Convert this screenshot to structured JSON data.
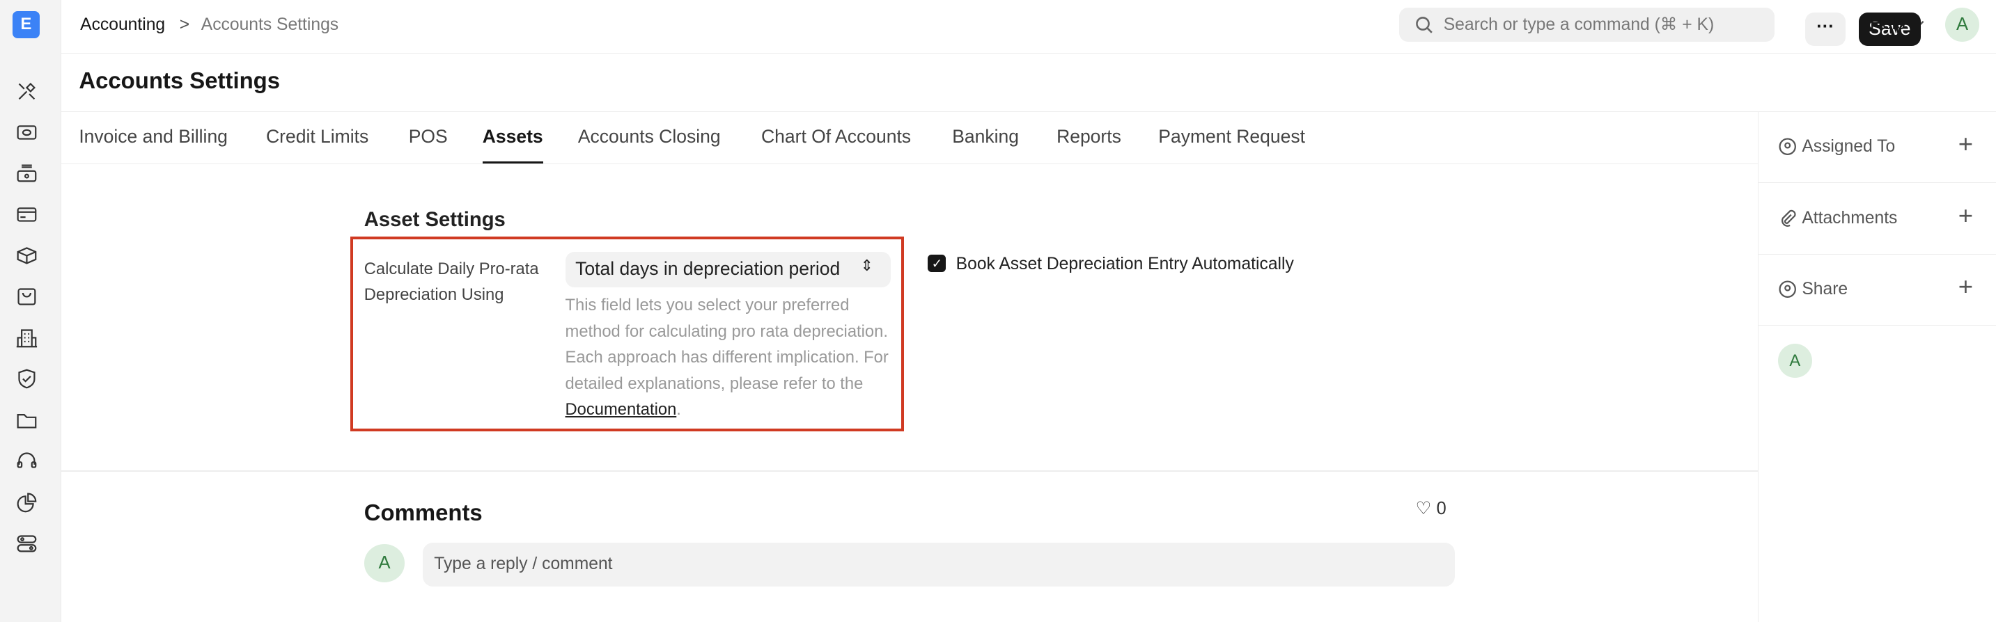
{
  "app": {
    "logo": "E",
    "accent": "#3b82f6"
  },
  "sidebar": {
    "icons": [
      "tools-icon",
      "money-icon",
      "cash-register-icon",
      "credit-card-icon",
      "box-icon",
      "shopping-bag-icon",
      "building-icon",
      "shield-check-icon",
      "folder-icon",
      "headset-icon",
      "pie-chart-icon",
      "toggles-icon"
    ]
  },
  "breadcrumb": {
    "parent": "Accounting",
    "separator": ">",
    "current": "Accounts Settings"
  },
  "search": {
    "placeholder": "Search or type a command (⌘ + K)"
  },
  "header": {
    "help": "Help",
    "user_initial": "A"
  },
  "page": {
    "title": "Accounts Settings",
    "more": "···",
    "save": "Save"
  },
  "tabs": [
    {
      "label": "Invoice and Billing"
    },
    {
      "label": "Credit Limits"
    },
    {
      "label": "POS"
    },
    {
      "label": "Assets",
      "active": true
    },
    {
      "label": "Accounts Closing"
    },
    {
      "label": "Chart Of Accounts"
    },
    {
      "label": "Banking"
    },
    {
      "label": "Reports"
    },
    {
      "label": "Payment Request"
    }
  ],
  "section": {
    "title": "Asset Settings",
    "field_label": "Calculate Daily Pro-rata Depreciation Using",
    "field_value": "Total days in depreciation period",
    "description": "This field lets you select your preferred method for calculating pro rata depreciation. Each approach has different implication. For detailed explanations, please refer to the ",
    "doc_link": "Documentation",
    "doc_suffix": ".",
    "checkbox_label": "Book Asset Depreciation Entry Automatically",
    "checkbox_checked": true,
    "highlight_color": "#d03a22"
  },
  "right_panel": {
    "assigned": "Assigned To",
    "attachments": "Attachments",
    "share": "Share",
    "plus": "+",
    "user_initial": "A"
  },
  "comments": {
    "title": "Comments",
    "likes": "0",
    "avatar": "A",
    "placeholder": "Type a reply / comment"
  }
}
